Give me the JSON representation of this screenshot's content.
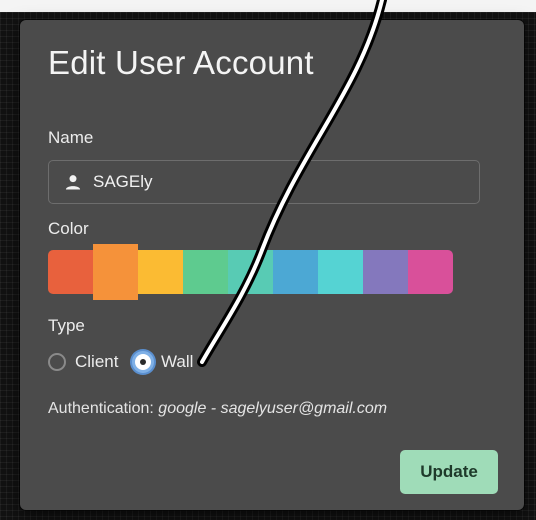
{
  "dialog": {
    "title": "Edit User Account",
    "name_label": "Name",
    "name_value": "SAGEly",
    "color_label": "Color",
    "type_label": "Type",
    "types": [
      {
        "label": "Client",
        "selected": false
      },
      {
        "label": "Wall",
        "selected": true
      }
    ],
    "auth_prefix": "Authentication: ",
    "auth_provider": "google",
    "auth_separator": " - ",
    "auth_email": "sagelyuser@gmail.com",
    "update_label": "Update"
  },
  "colors": [
    "#e8613d",
    "#f5923a",
    "#fbbb33",
    "#5ecb8f",
    "#58cbb4",
    "#4ca8d4",
    "#55d3d3",
    "#8478bd",
    "#d9509a"
  ],
  "selected_color_index": 1,
  "icons": {
    "name_icon": "user-icon"
  },
  "accent": {
    "update_button": "#9fdcb8",
    "radio_selected": "#7fb0e6"
  }
}
